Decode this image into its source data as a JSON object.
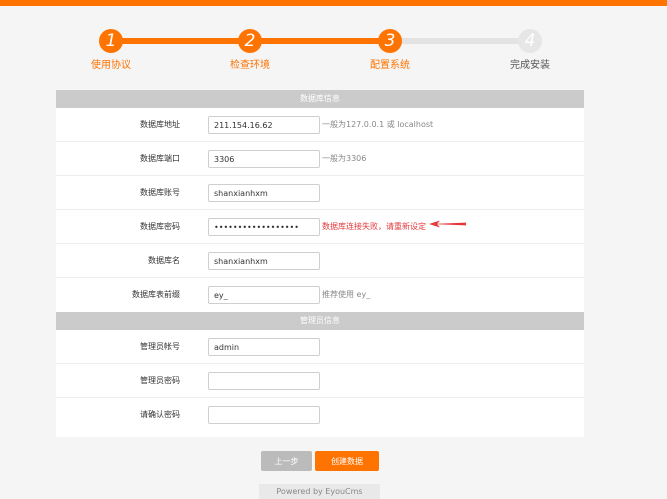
{
  "steps": [
    {
      "number": "1",
      "label": "使用协议",
      "state": "done"
    },
    {
      "number": "2",
      "label": "检查环境",
      "state": "done"
    },
    {
      "number": "3",
      "label": "配置系统",
      "state": "done"
    },
    {
      "number": "4",
      "label": "完成安装",
      "state": "todo"
    }
  ],
  "database_section": {
    "title": "数据库信息",
    "host": {
      "label": "数据库地址",
      "value": "211.154.16.62",
      "hint": "一般为127.0.0.1 或 localhost"
    },
    "port": {
      "label": "数据库端口",
      "value": "3306",
      "hint": "一般为3306"
    },
    "user": {
      "label": "数据库账号",
      "value": "shanxianhxm"
    },
    "password": {
      "label": "数据库密码",
      "value": "••••••••••••••••••",
      "error": "数据库连接失败，请重新设定"
    },
    "name": {
      "label": "数据库名",
      "value": "shanxianhxm"
    },
    "prefix": {
      "label": "数据库表前缀",
      "value": "ey_",
      "hint": "推荐使用 ey_"
    }
  },
  "admin_section": {
    "title": "管理员信息",
    "account": {
      "label": "管理员帐号",
      "value": "admin"
    },
    "password": {
      "label": "管理员密码",
      "value": ""
    },
    "confirm": {
      "label": "请确认密码",
      "value": ""
    }
  },
  "buttons": {
    "prev": "上一步",
    "create": "创建数据"
  },
  "footer": "Powered by EyouCms",
  "colors": {
    "accent": "#ff7300",
    "error": "#e4393c",
    "inactive": "#e3e3e3"
  }
}
